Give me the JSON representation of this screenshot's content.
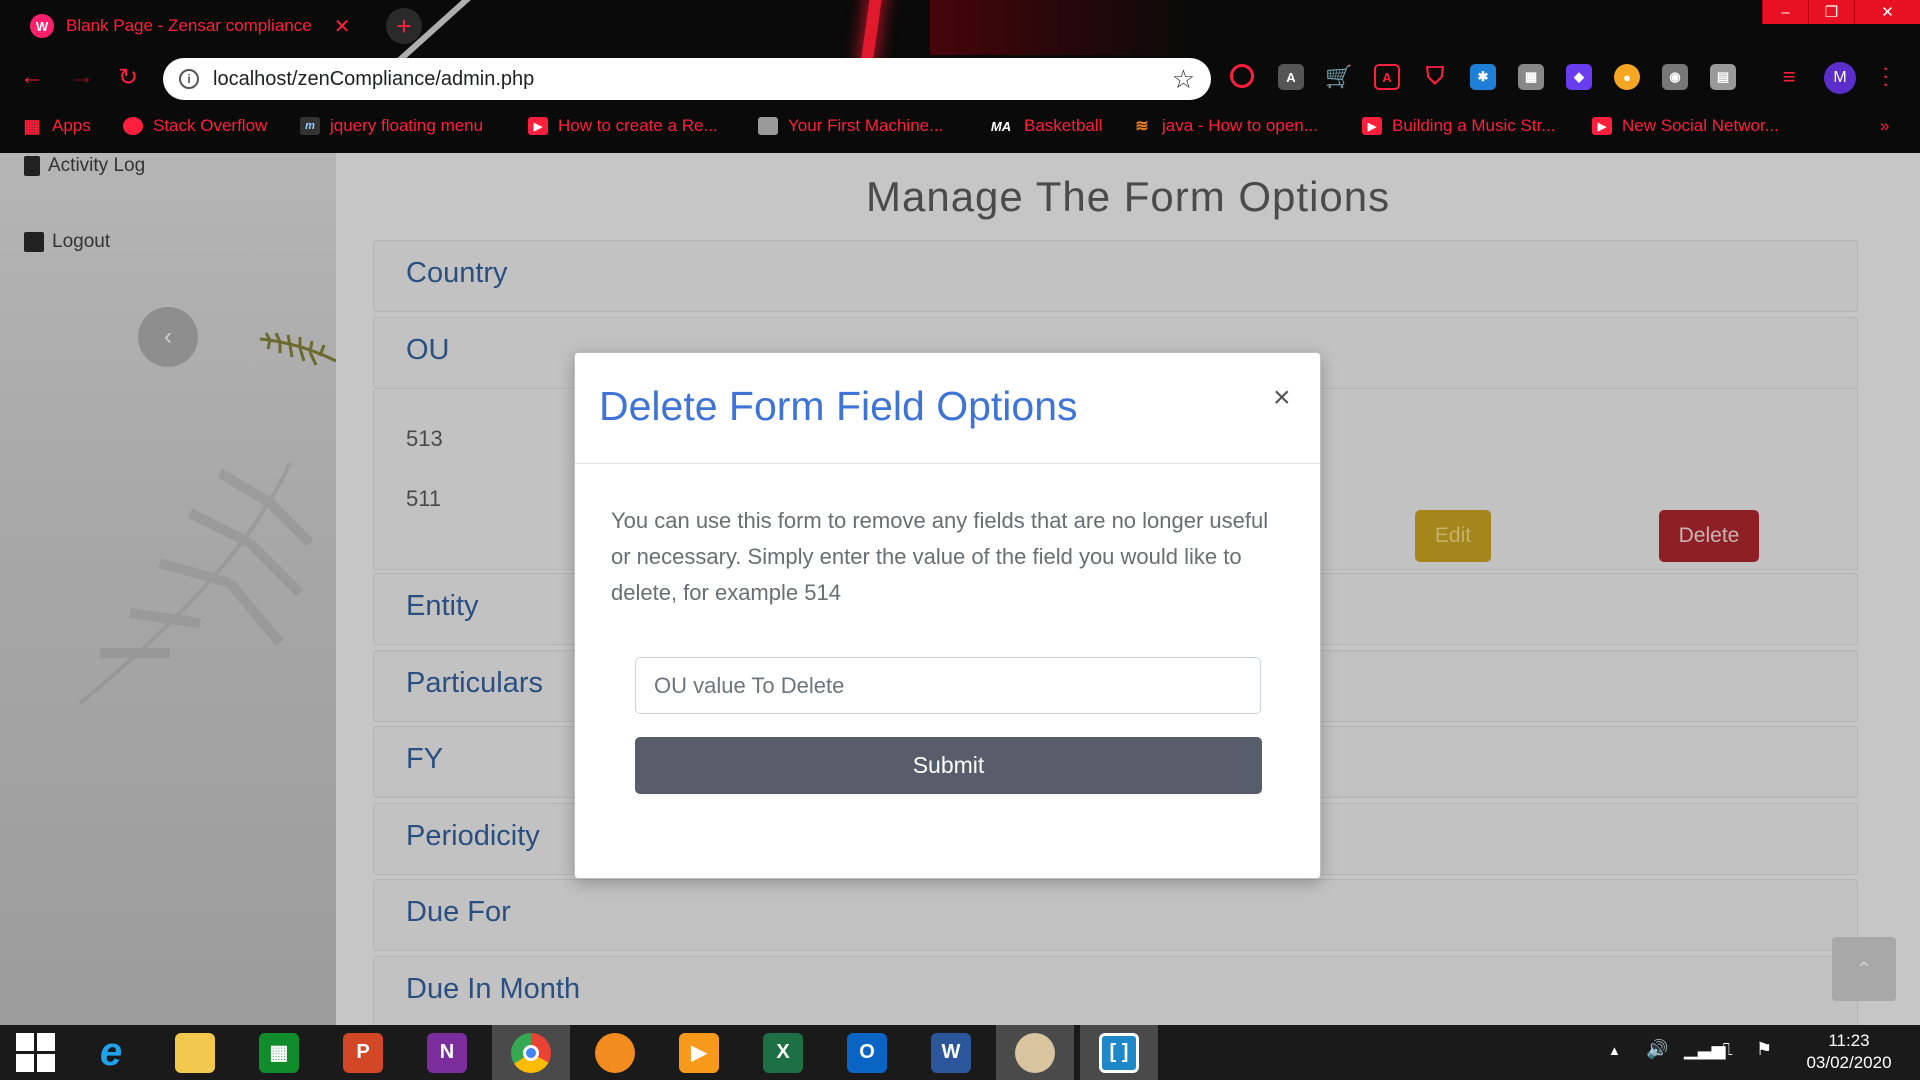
{
  "browser": {
    "tab_title": "Blank Page - Zensar compliance",
    "tab_favicon": "W",
    "new_tab": "+",
    "url": "localhost/zenCompliance/admin.php",
    "profile_initial": "M",
    "window_buttons": [
      "–",
      "❐",
      "✕"
    ],
    "bookmarks": [
      {
        "label": "Apps",
        "icon": "apps-grid-icon"
      },
      {
        "label": "Stack Overflow",
        "icon": "stackoverflow-icon"
      },
      {
        "label": "jquery floating menu",
        "icon": "m-logo-icon"
      },
      {
        "label": "How to create a Re...",
        "icon": "youtube-icon"
      },
      {
        "label": "Your First Machine...",
        "icon": "thumbnail-icon"
      },
      {
        "label": "Basketball",
        "icon": "ma-logo-icon"
      },
      {
        "label": "java - How to open...",
        "icon": "stackoverflow-icon"
      },
      {
        "label": "Building a Music Str...",
        "icon": "youtube-icon"
      },
      {
        "label": "New Social Networ...",
        "icon": "youtube-icon"
      }
    ]
  },
  "sidebar": {
    "items": [
      {
        "label": "Activity Log",
        "icon": "book-icon"
      },
      {
        "label": "Logout",
        "icon": "door-icon"
      }
    ]
  },
  "main": {
    "title": "Manage The Form Options",
    "sections": [
      "Country",
      "OU",
      "Entity",
      "Particulars",
      "FY",
      "Periodicity",
      "Due For",
      "Due In Month"
    ],
    "ou_values": [
      "513",
      "511"
    ],
    "edit_label": "Edit",
    "delete_label": "Delete"
  },
  "modal": {
    "title": "Delete Form Field Options",
    "close": "×",
    "description": "You can use this form to remove any fields that are no longer useful or necessary. Simply enter the value of the field you would like to delete, for example 514",
    "input_placeholder": "OU value To Delete",
    "submit_label": "Submit"
  },
  "taskbar": {
    "time": "11:23",
    "date": "03/02/2020"
  },
  "colors": {
    "accent_red": "#ff1f3d",
    "modal_title": "#3e74d8",
    "submit_bg": "#585d6b"
  }
}
